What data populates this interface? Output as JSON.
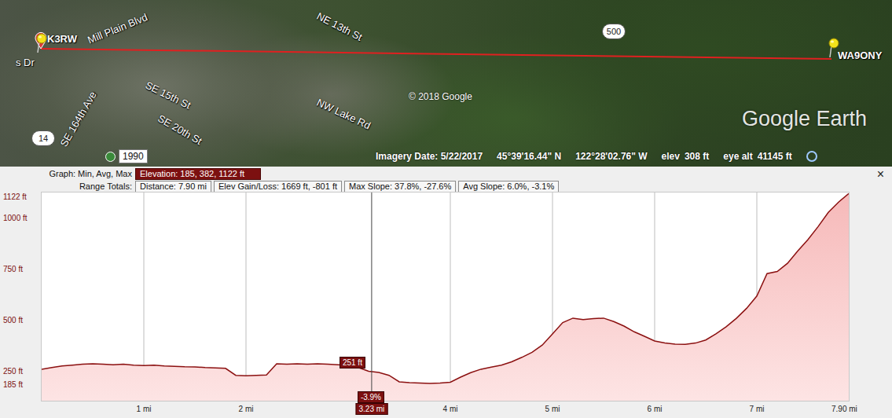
{
  "map": {
    "labels": [
      {
        "text": "s Dr"
      },
      {
        "text": "Mill Plain Blvd"
      },
      {
        "text": "NE 13th St"
      },
      {
        "text": "SE 164th Ave"
      },
      {
        "text": "SE 15th St"
      },
      {
        "text": "SE 20th St"
      },
      {
        "text": "NW Lake Rd"
      }
    ],
    "shields": [
      {
        "text": "500"
      },
      {
        "text": "14"
      }
    ],
    "placemarks": [
      {
        "name": "K3RW"
      },
      {
        "name": "WA9ONY"
      }
    ],
    "year_badge": "1990",
    "copyright": "© 2018 Google",
    "logo": "Google Earth",
    "status_bar": {
      "imagery_date": "Imagery Date: 5/22/2017",
      "latitude": "45°39'16.44\" N",
      "longitude": "122°28'02.76\" W",
      "elev_label": "elev",
      "elev": "308 ft",
      "eye_alt_label": "eye alt",
      "eye_alt": "41145 ft"
    }
  },
  "profile": {
    "close": "×",
    "graph_label": "Graph: Min, Avg, Max",
    "graph_value": "Elevation: 185, 382, 1122 ft",
    "range_label": "Range Totals:",
    "totals": [
      "Distance: 7.90 mi",
      "Elev Gain/Loss: 1669 ft, -801 ft",
      "Max Slope: 37.8%, -27.6%",
      "Avg Slope: 6.0%, -3.1%"
    ],
    "chart": {
      "step_mi": 0.1,
      "series": [
        {
          "values": [
            262,
            270,
            278,
            282,
            286,
            288,
            286,
            284,
            286,
            282,
            280,
            282,
            278,
            276,
            274,
            273,
            270,
            268,
            266,
            232,
            230,
            232,
            234,
            288,
            286,
            288,
            286,
            288,
            287,
            284,
            281,
            270,
            252,
            246,
            232,
            200,
            196,
            194,
            192,
            194,
            198,
            223,
            245,
            262,
            272,
            282,
            298,
            320,
            345,
            380,
            435,
            490,
            512,
            505,
            510,
            512,
            495,
            473,
            445,
            423,
            400,
            390,
            385,
            384,
            390,
            405,
            435,
            470,
            511,
            560,
            620,
            730,
            740,
            780,
            840,
            896,
            960,
            1030,
            1080,
            1122
          ]
        }
      ],
      "y_ticks": [
        {
          "label": "1122 ft",
          "value": 1122
        },
        {
          "label": "1000 ft",
          "value": 1000
        },
        {
          "label": "750 ft",
          "value": 750
        },
        {
          "label": "500 ft",
          "value": 500
        },
        {
          "label": "250 ft",
          "value": 250
        },
        {
          "label": "185 ft",
          "value": 185
        }
      ],
      "x_ticks": [
        {
          "label": "1 mi",
          "value": 1
        },
        {
          "label": "2 mi",
          "value": 2
        },
        {
          "label": "4 mi",
          "value": 4
        },
        {
          "label": "5 mi",
          "value": 5
        },
        {
          "label": "6 mi",
          "value": 6
        },
        {
          "label": "7 mi",
          "value": 7
        },
        {
          "label": "7.90 mi",
          "value": 7.9
        }
      ],
      "cursor": {
        "distance": 3.23,
        "label": "3.23 mi",
        "elevation": "251 ft",
        "slope": "-3.9%"
      }
    }
  }
}
